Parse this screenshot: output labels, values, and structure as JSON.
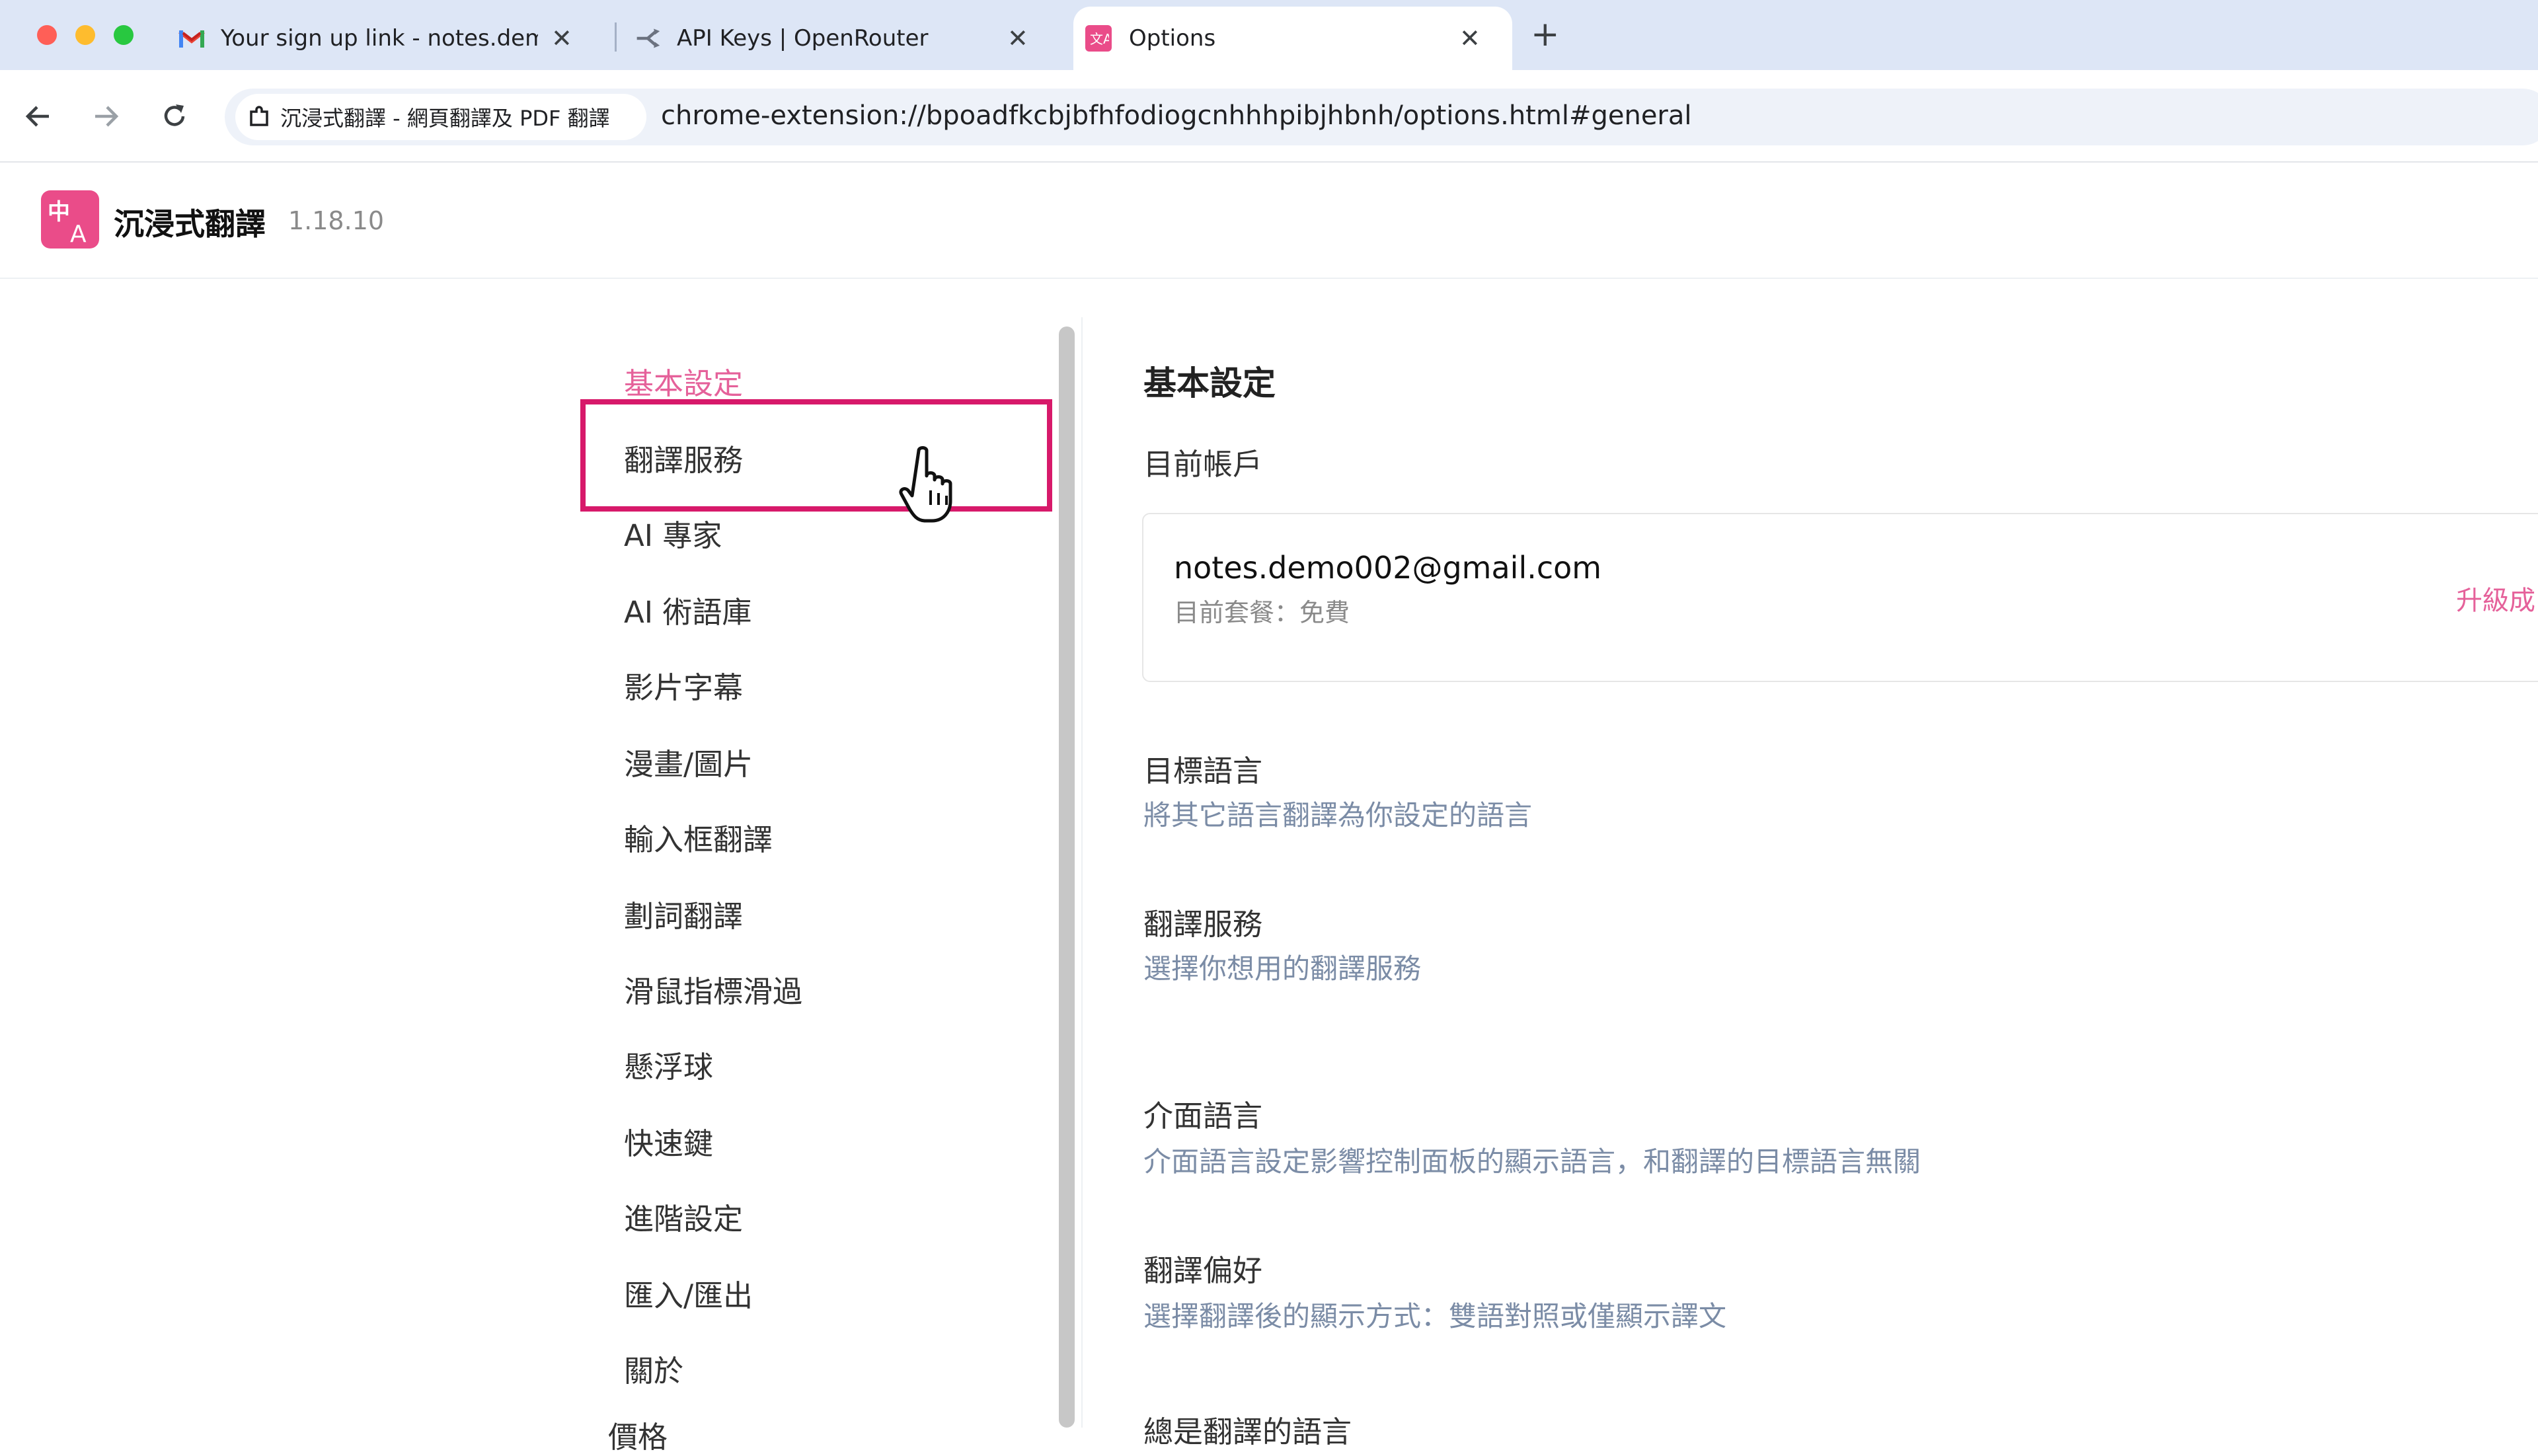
{
  "browser": {
    "tabs": [
      {
        "title": "Your sign up link - notes.demo",
        "icon": "gmail-icon"
      },
      {
        "title": "API Keys | OpenRouter",
        "icon": "openrouter-icon"
      },
      {
        "title": "Options",
        "icon": "extension-icon",
        "active": true
      }
    ],
    "new_tab_label": "+",
    "site_chip_label": "沉浸式翻譯 - 網頁翻譯及 PDF 翻譯",
    "url": "chrome-extension://bpoadfkcbjbfhfodiogcnhhhpibjhbnh/options.html#general"
  },
  "app": {
    "name": "沉浸式翻譯",
    "version": "1.18.10",
    "brand_color": "#ea4c89"
  },
  "sidebar": {
    "items": [
      {
        "label": "基本設定",
        "active": true
      },
      {
        "label": "翻譯服務",
        "highlighted": true
      },
      {
        "label": "AI 專家"
      },
      {
        "label": "AI 術語庫"
      },
      {
        "label": "影片字幕"
      },
      {
        "label": "漫畫/圖片"
      },
      {
        "label": "輸入框翻譯"
      },
      {
        "label": "劃詞翻譯"
      },
      {
        "label": "滑鼠指標滑過"
      },
      {
        "label": "懸浮球"
      },
      {
        "label": "快速鍵"
      },
      {
        "label": "進階設定"
      },
      {
        "label": "匯入/匯出"
      },
      {
        "label": "關於"
      },
      {
        "label": "價格"
      }
    ]
  },
  "main": {
    "title": "基本設定",
    "account_label": "目前帳戶",
    "account": {
      "email": "notes.demo002@gmail.com",
      "plan": "目前套餐：免費",
      "upgrade": "升級成"
    },
    "sections": [
      {
        "title": "目標語言",
        "description": "將其它語言翻譯為你設定的語言"
      },
      {
        "title": "翻譯服務",
        "description": "選擇你想用的翻譯服務"
      },
      {
        "title": "介面語言",
        "description": "介面語言設定影響控制面板的顯示語言，和翻譯的目標語言無關"
      },
      {
        "title": "翻譯偏好",
        "description": "選擇翻譯後的顯示方式：雙語對照或僅顯示譯文"
      },
      {
        "title": "總是翻譯的語言",
        "description": ""
      }
    ]
  },
  "colors": {
    "accent_pink": "#e5619a",
    "highlight_box": "#d7196a",
    "muted_blue": "#7b8ca6"
  }
}
